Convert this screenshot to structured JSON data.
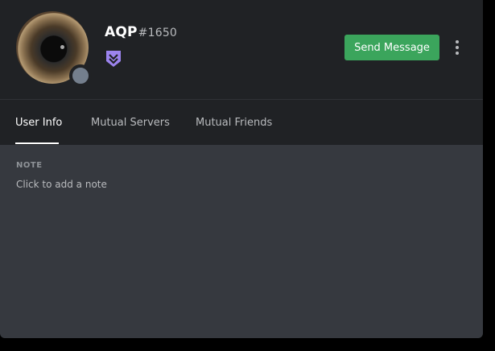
{
  "profile": {
    "username": "AQP",
    "discriminator": "#1650",
    "status": "offline",
    "status_color": "#747f8d",
    "badge_icon": "hypesquad-badge-icon",
    "badge_color": "#9c84ef"
  },
  "actions": {
    "send_message_label": "Send Message",
    "send_message_color": "#3ba55c",
    "more_icon": "more-vertical-icon"
  },
  "tabs": [
    {
      "label": "User Info",
      "active": true
    },
    {
      "label": "Mutual Servers",
      "active": false
    },
    {
      "label": "Mutual Friends",
      "active": false
    }
  ],
  "note": {
    "title": "NOTE",
    "placeholder": "Click to add a note"
  }
}
